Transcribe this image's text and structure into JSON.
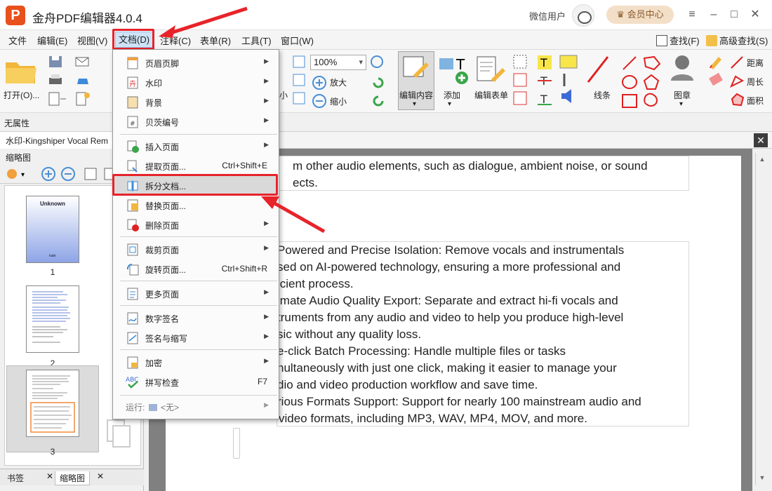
{
  "app": {
    "logo": "P",
    "title": "金舟PDF编辑器4.0.4",
    "user": "微信用户",
    "vip": "会员中心"
  },
  "window": {
    "minimize": "–",
    "maximize": "□",
    "close": "✕",
    "settings": "≡"
  },
  "menubar": {
    "items": [
      "文件",
      "编辑(E)",
      "视图(V)",
      "文档(D)",
      "注释(C)",
      "表单(R)",
      "工具(T)",
      "窗口(W)"
    ],
    "find": "查找(F)",
    "advanced_find": "高级查找(S)"
  },
  "toolbar": {
    "open": "打开(O)...",
    "zoom_value": "100%",
    "zoom_in": "放大",
    "zoom_out": "缩小",
    "small_label": "小",
    "edit_content": "编辑内容",
    "add": "添加",
    "edit_form": "编辑表单",
    "line": "线条",
    "stamp": "图章",
    "distance": "距离",
    "perimeter": "周长",
    "area": "面积"
  },
  "propbar": {
    "label": "无属性"
  },
  "docbar": {
    "tab_title": "水印-Kingshiper Vocal Rem"
  },
  "leftpanel": {
    "title": "缩略图",
    "thumbs": [
      {
        "num": "1",
        "title": "Unknown",
        "footer": "kate"
      },
      {
        "num": "2"
      },
      {
        "num": "3"
      }
    ],
    "tabs": [
      "书签",
      "缩略图"
    ]
  },
  "document": {
    "block1": [
      "m other audio elements, such as dialogue, ambient noise, or sound",
      "ects."
    ],
    "block2": [
      "Powered and Precise Isolation: Remove vocals and instrumentals",
      "sed on AI-powered technology, ensuring a more professional and",
      "icient process.",
      "imate Audio Quality Export: Separate and extract hi-fi vocals and",
      "truments from any audio and video to help you produce high-level",
      "sic without any quality loss.",
      "e-click  Batch  Processing:  Handle  multiple  files  or  tasks",
      "nultaneously with just one click, making it easier to manage your",
      "dio and video production workflow and save time.",
      "rious Formats Support: Support for nearly 100 mainstream audio and",
      "video formats, including MP3, WAV, MP4, MOV, and more."
    ]
  },
  "dropdown": {
    "items": [
      {
        "label": "页眉页脚",
        "icon": "header-footer-icon",
        "arrow": true
      },
      {
        "label": "水印",
        "icon": "watermark-icon",
        "arrow": true
      },
      {
        "label": "背景",
        "icon": "background-icon",
        "arrow": true
      },
      {
        "label": "贝茨编号",
        "icon": "bates-icon",
        "arrow": true
      },
      {
        "label": "插入页面",
        "icon": "insert-page-icon",
        "arrow": true
      },
      {
        "label": "提取页面...",
        "icon": "extract-page-icon",
        "shortcut": "Ctrl+Shift+E"
      },
      {
        "label": "拆分文档...",
        "icon": "split-doc-icon"
      },
      {
        "label": "替换页面...",
        "icon": "replace-page-icon"
      },
      {
        "label": "删除页面",
        "icon": "delete-page-icon",
        "arrow": true
      },
      {
        "label": "裁剪页面",
        "icon": "crop-page-icon",
        "arrow": true
      },
      {
        "label": "旋转页面...",
        "icon": "rotate-page-icon",
        "shortcut": "Ctrl+Shift+R"
      },
      {
        "label": "更多页面",
        "icon": "more-pages-icon",
        "arrow": true
      },
      {
        "label": "数字签名",
        "icon": "digital-sign-icon",
        "arrow": true
      },
      {
        "label": "签名与缩写",
        "icon": "sign-initials-icon",
        "arrow": true
      },
      {
        "label": "加密",
        "icon": "encrypt-icon",
        "arrow": true
      },
      {
        "label": "拼写检查",
        "icon": "spellcheck-icon",
        "shortcut": "F7"
      }
    ],
    "run_label": "运行:",
    "run_value": "<无>"
  },
  "colors": {
    "accent_red": "#e8232a",
    "brand_orange": "#e8501c"
  }
}
